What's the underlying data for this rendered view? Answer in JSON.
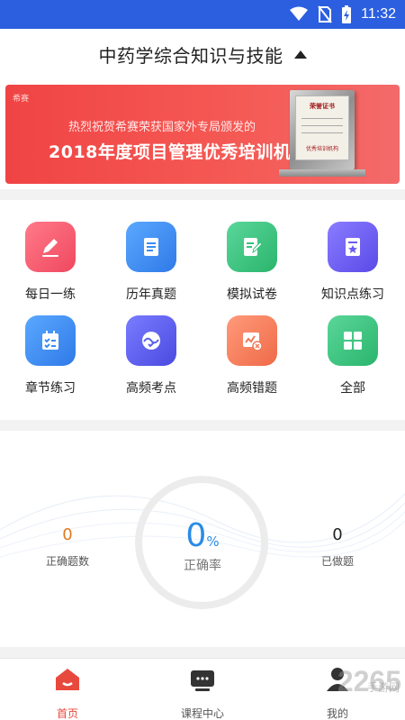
{
  "status_bar": {
    "time": "11:32",
    "icons": [
      "wifi-icon",
      "no-sim-icon",
      "battery-charging-icon"
    ]
  },
  "header": {
    "title": "中药学综合知识与技能",
    "dropdown_icon": "caret-up-icon"
  },
  "banner": {
    "brand": "希赛",
    "subtitle": "热烈祝贺希赛荣获国家外专局颁发的",
    "headline": "2018年度项目管理优秀培训机构",
    "plaque_title": "荣誉证书",
    "plaque_footer": "优秀培训机构"
  },
  "grid": {
    "items": [
      {
        "label": "每日一练",
        "icon": "pencil-icon",
        "color": "#f25a70"
      },
      {
        "label": "历年真题",
        "icon": "document-icon",
        "color": "#3a8df0"
      },
      {
        "label": "模拟试卷",
        "icon": "edit-doc-icon",
        "color": "#36c27c"
      },
      {
        "label": "知识点练习",
        "icon": "star-doc-icon",
        "color": "#6a5cf0"
      },
      {
        "label": "章节练习",
        "icon": "checklist-icon",
        "color": "#3a8df0"
      },
      {
        "label": "高频考点",
        "icon": "wave-check-icon",
        "color": "#5a5ff0"
      },
      {
        "label": "高频错题",
        "icon": "chart-error-icon",
        "color": "#f07a5a"
      },
      {
        "label": "全部",
        "icon": "grid-icon",
        "color": "#36c27c"
      }
    ]
  },
  "stats": {
    "correct_count": {
      "value": "0",
      "label": "正确题数"
    },
    "accuracy": {
      "value": "0",
      "unit": "%",
      "label": "正确率"
    },
    "done_count": {
      "value": "0",
      "label": "已做题"
    }
  },
  "bottom_nav": {
    "items": [
      {
        "label": "首页",
        "icon": "home-icon",
        "active": true
      },
      {
        "label": "课程中心",
        "icon": "course-icon",
        "active": false
      },
      {
        "label": "我的",
        "icon": "user-icon",
        "active": false
      }
    ],
    "active_color": "#e8493d"
  },
  "watermark": {
    "text": "2265",
    "sub": "手游网"
  }
}
